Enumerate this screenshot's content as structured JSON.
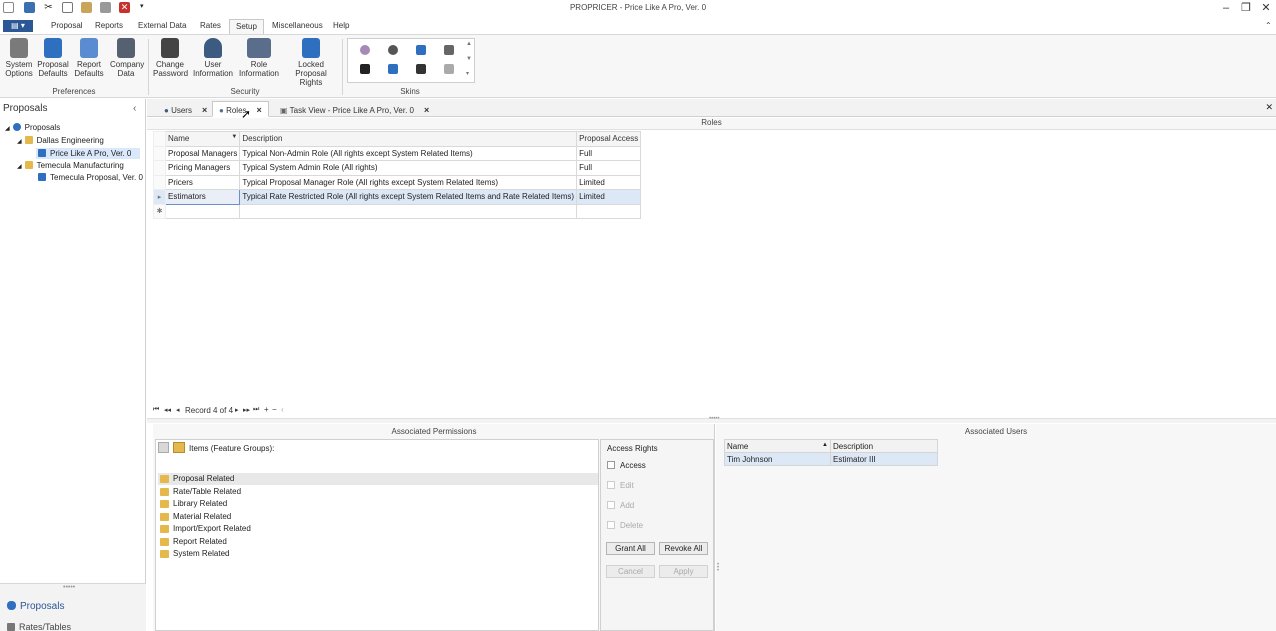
{
  "window": {
    "title": "PROPRICER - Price Like A Pro, Ver. 0"
  },
  "menu": {
    "items": [
      "Proposal",
      "Reports",
      "External Data",
      "Rates",
      "Setup",
      "Miscellaneous",
      "Help"
    ],
    "active": "Setup"
  },
  "ribbon": {
    "groups": {
      "preferences": "Preferences",
      "security": "Security",
      "skins": "Skins"
    },
    "buttons": {
      "system_options": "System Options",
      "proposal_defaults": "Proposal Defaults",
      "report_defaults": "Report Defaults",
      "company_data": "Company Data",
      "change_password": "Change Password",
      "user_information": "User Information",
      "role_information": "Role Information",
      "locked_proposal_rights": "Locked Proposal Rights"
    }
  },
  "left_panel": {
    "title": "Proposals",
    "tree": {
      "root": "Proposals",
      "dallas": "Dallas Engineering",
      "dallas_child": "Price Like A Pro, Ver. 0",
      "temecula": "Temecula Manufacturing",
      "temecula_child": "Temecula Proposal, Ver. 0"
    },
    "bottom_nav": {
      "proposals": "Proposals",
      "rates_tables": "Rates/Tables"
    }
  },
  "tabs": {
    "users": "Users",
    "roles": "Roles",
    "task_view": "Task View - Price Like A Pro, Ver. 0"
  },
  "roles_grid": {
    "caption": "Roles",
    "headers": {
      "name": "Name",
      "description": "Description",
      "access": "Proposal Access"
    },
    "rows": [
      {
        "name": "Proposal Managers",
        "description": "Typical Non-Admin Role (All rights except System Related Items)",
        "access": "Full"
      },
      {
        "name": "Pricing Managers",
        "description": "Typical System Admin Role (All rights)",
        "access": "Full"
      },
      {
        "name": "Pricers",
        "description": "Typical Proposal Manager Role (All rights except System Related Items)",
        "access": "Limited"
      },
      {
        "name": "Estimators",
        "description": "Typical Rate Restricted Role (All rights except System Related Items and Rate Related Items)",
        "access": "Limited"
      }
    ],
    "record_nav": "Record 4 of 4"
  },
  "permissions": {
    "caption": "Associated Permissions",
    "items_label": "Items (Feature Groups):",
    "items": [
      "Proposal Related",
      "Rate/Table Related",
      "Library Related",
      "Material Related",
      "Import/Export Related",
      "Report Related",
      "System Related"
    ],
    "access_rights": {
      "title": "Access Rights",
      "access": "Access",
      "edit": "Edit",
      "add": "Add",
      "delete": "Delete"
    },
    "buttons": {
      "grant_all": "Grant All",
      "revoke_all": "Revoke All",
      "cancel": "Cancel",
      "apply": "Apply"
    }
  },
  "associated_users": {
    "caption": "Associated Users",
    "headers": {
      "name": "Name",
      "description": "Description"
    },
    "rows": [
      {
        "name": "Tim Johnson",
        "description": "Estimator III"
      }
    ]
  },
  "colors": {
    "accent": "#2b5797",
    "selection": "#dde8f6",
    "folder": "#e4b84a"
  }
}
